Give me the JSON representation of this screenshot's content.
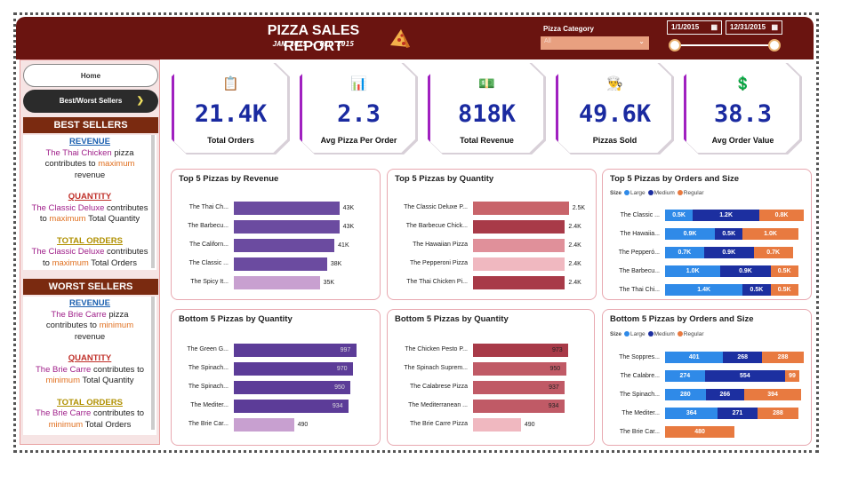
{
  "header": {
    "title": "PIZZA SALES REPORT",
    "subtitle": "JAN 2015 - DEC 2015",
    "category_label": "Pizza Category",
    "category_value": "All",
    "date_start": "1/1/2015",
    "date_end": "12/31/2015",
    "bg_color": "#6a1410"
  },
  "nav": {
    "home": "Home",
    "best_worst": "Best/Worst Sellers"
  },
  "best": {
    "heading": "BEST SELLERS",
    "revenue_h": "REVENUE",
    "revenue_pizza": "The Thai Chicken",
    "revenue_t1": "pizza",
    "revenue_t2": "contributes to",
    "revenue_t3": "maximum",
    "revenue_t4": "revenue",
    "qty_h": "QUANTITY",
    "qty_pizza": "The Classic Deluxe",
    "qty_t1": "contributes",
    "qty_t2": "to",
    "qty_t3": "maximum",
    "qty_t4": "Total Quantity",
    "ord_h": "TOTAL ORDERS",
    "ord_pizza": "The Classic Deluxe",
    "ord_t1": "contributes",
    "ord_t2": "to",
    "ord_t3": "maximum",
    "ord_t4": "Total Orders"
  },
  "worst": {
    "heading": "WORST SELLERS",
    "revenue_h": "REVENUE",
    "revenue_pizza": "The Brie Carre",
    "revenue_t1": "pizza",
    "revenue_t2": "contributes to",
    "revenue_t3": "minimum",
    "revenue_t4": "revenue",
    "qty_h": "QUANTITY",
    "qty_pizza": "The Brie Carre",
    "qty_t1": "contributes to",
    "qty_t3": "minimum",
    "qty_t4": "Total Quantity",
    "ord_h": "TOTAL ORDERS",
    "ord_pizza": "The Brie Carre",
    "ord_t1": "contributes to",
    "ord_t3": "minimum",
    "ord_t4": "Total Orders"
  },
  "kpis": [
    {
      "value": "21.4K",
      "label": "Total Orders",
      "icon": "clipboard-icon"
    },
    {
      "value": "2.3",
      "label": "Avg Pizza Per Order",
      "icon": "bar-chart-icon"
    },
    {
      "value": "818K",
      "label": "Total Revenue",
      "icon": "money-icon"
    },
    {
      "value": "49.6K",
      "label": "Pizzas Sold",
      "icon": "chef-icon"
    },
    {
      "value": "38.3",
      "label": "Avg Order Value",
      "icon": "dollar-icon"
    }
  ],
  "legend": {
    "size": "Size",
    "large": "Large",
    "medium": "Medium",
    "regular": "Regular"
  },
  "chart_data": [
    {
      "type": "bar",
      "title": "Top 5 Pizzas by Revenue",
      "categories": [
        "The Thai Ch...",
        "The Barbecu...",
        "The Californ...",
        "The Classic ...",
        "The Spicy It..."
      ],
      "values": [
        43,
        43,
        41,
        38,
        35
      ],
      "labels": [
        "43K",
        "43K",
        "41K",
        "38K",
        "35K"
      ],
      "colors": [
        "#6b4ba0",
        "#6b4ba0",
        "#6b4ba0",
        "#6b4ba0",
        "#c8a0d0"
      ],
      "xlim": [
        0,
        50
      ]
    },
    {
      "type": "bar",
      "title": "Top 5 Pizzas by Quantity",
      "categories": [
        "The Classic Deluxe P...",
        "The Barbecue Chick...",
        "The Hawaiian Pizza",
        "The Pepperoni Pizza",
        "The Thai Chicken Pi..."
      ],
      "values": [
        2.5,
        2.4,
        2.4,
        2.4,
        2.4
      ],
      "labels": [
        "2.5K",
        "2.4K",
        "2.4K",
        "2.4K",
        "2.4K"
      ],
      "colors": [
        "#c8646a",
        "#a83a48",
        "#e0909a",
        "#f0b8c0",
        "#a83a48"
      ],
      "xlim": [
        0,
        2.6
      ]
    },
    {
      "type": "bar",
      "title": "Top 5 Pizzas by Orders and Size",
      "categories": [
        "The Classic ...",
        "The Hawaiia...",
        "The Pepperó...",
        "The Barbecu...",
        "The Thai Chi..."
      ],
      "series": [
        {
          "name": "Large",
          "values": [
            0.5,
            0.9,
            0.7,
            1.0,
            1.4
          ],
          "labels": [
            "0.5K",
            "0.9K",
            "0.7K",
            "1.0K",
            "1.4K"
          ],
          "color": "#2f8ae8"
        },
        {
          "name": "Medium",
          "values": [
            1.2,
            0.5,
            0.9,
            0.9,
            0.5
          ],
          "labels": [
            "1.2K",
            "0.5K",
            "0.9K",
            "0.9K",
            "0.5K"
          ],
          "color": "#1c2fa0"
        },
        {
          "name": "Regular",
          "values": [
            0.8,
            1.0,
            0.7,
            0.5,
            0.5
          ],
          "labels": [
            "0.8K",
            "1.0K",
            "0.7K",
            "0.5K",
            "0.5K"
          ],
          "color": "#e87a40"
        }
      ]
    },
    {
      "type": "bar",
      "title": "Bottom 5 Pizzas by Quantity",
      "categories": [
        "The Green G...",
        "The Spinach...",
        "The Spinach...",
        "The Mediter...",
        "The Brie Car..."
      ],
      "values": [
        997,
        970,
        950,
        934,
        490
      ],
      "labels": [
        "997",
        "970",
        "950",
        "934",
        "490"
      ],
      "colors": [
        "#5c3c98",
        "#5c3c98",
        "#5c3c98",
        "#5c3c98",
        "#c8a0d0"
      ],
      "xlim": [
        0,
        1000
      ]
    },
    {
      "type": "bar",
      "title": "Bottom 5 Pizzas by Quantity",
      "categories": [
        "The Chicken Pesto P...",
        "The Spinach Suprem...",
        "The Calabrese Pizza",
        "The Mediterranean ...",
        "The Brie Carre Pizza"
      ],
      "values": [
        973,
        950,
        937,
        934,
        490
      ],
      "labels": [
        "973",
        "950",
        "937",
        "934",
        "490"
      ],
      "colors": [
        "#a83a48",
        "#c05a66",
        "#c05a66",
        "#c05a66",
        "#f0b8c0"
      ],
      "xlim": [
        0,
        1000
      ]
    },
    {
      "type": "bar",
      "title": "Bottom 5 Pizzas by Orders and Size",
      "categories": [
        "The Soppres...",
        "The Calabre...",
        "The Spinach...",
        "The Mediter...",
        "The Brie Car..."
      ],
      "series": [
        {
          "name": "Large",
          "values": [
            401,
            274,
            280,
            364,
            0
          ],
          "labels": [
            "401",
            "274",
            "280",
            "364",
            ""
          ],
          "color": "#2f8ae8"
        },
        {
          "name": "Medium",
          "values": [
            268,
            554,
            266,
            271,
            0
          ],
          "labels": [
            "268",
            "554",
            "266",
            "271",
            ""
          ],
          "color": "#1c2fa0"
        },
        {
          "name": "Regular",
          "values": [
            288,
            99,
            394,
            288,
            480
          ],
          "labels": [
            "288",
            "99",
            "394",
            "288",
            "480"
          ],
          "color": "#e87a40"
        }
      ]
    }
  ]
}
